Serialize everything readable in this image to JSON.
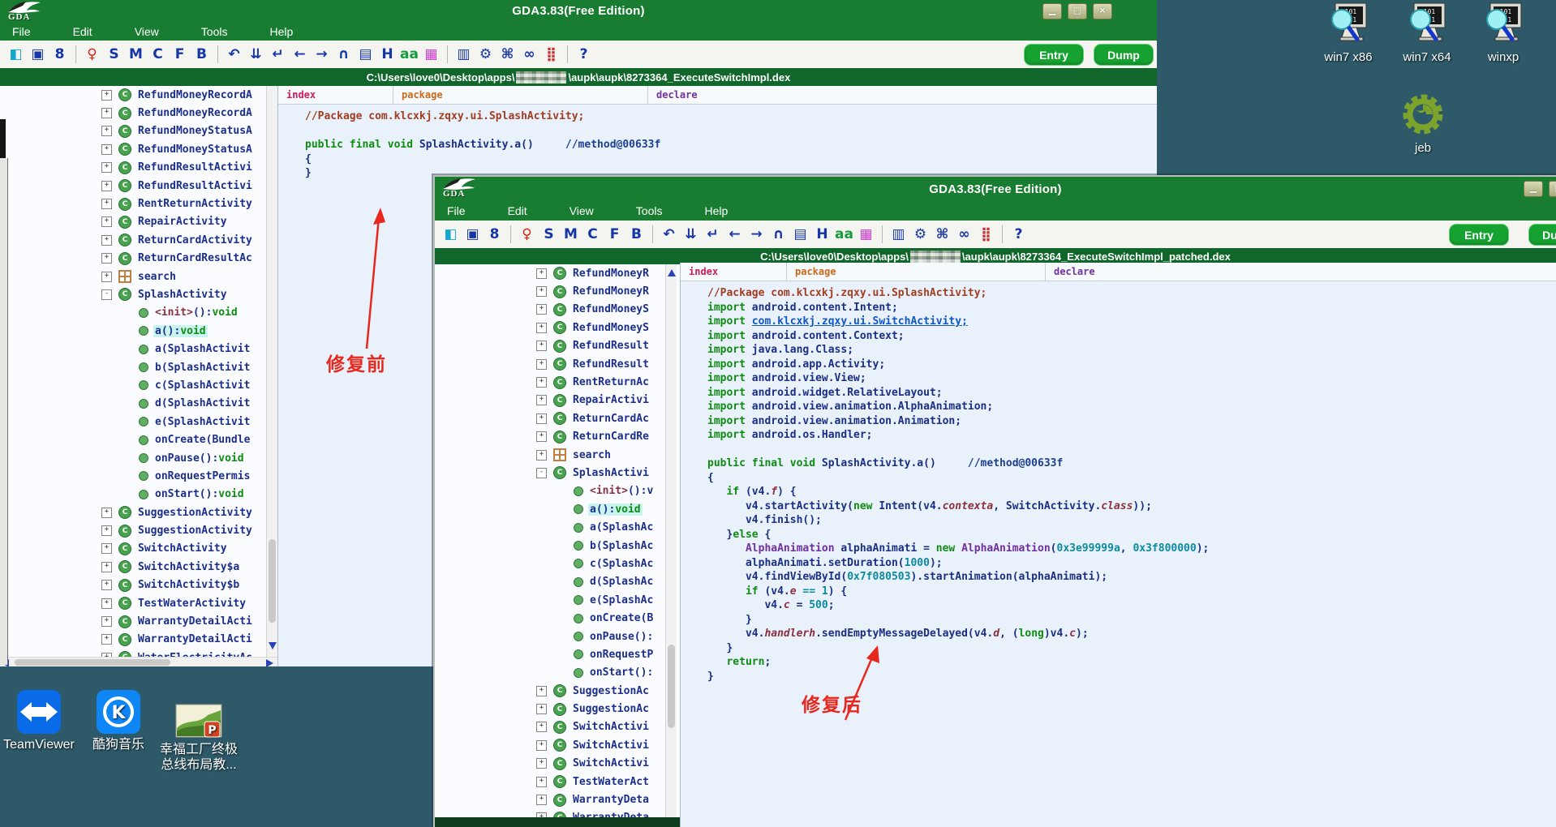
{
  "shared": {
    "title": "GDA3.83(Free Edition)",
    "logo": "GDA",
    "menus": [
      "File",
      "Edit",
      "View",
      "Tools",
      "Help"
    ],
    "toolbar": [
      {
        "g": "◧",
        "c": "#12a7cc",
        "n": "open-book-icon"
      },
      {
        "g": "▣",
        "c": "#1636a8",
        "n": "save-icon"
      },
      {
        "g": "8",
        "c": "#1636a8",
        "n": "link-icon"
      },
      {
        "sep": 1
      },
      {
        "g": "♀",
        "c": "#d42313",
        "n": "pin-icon"
      },
      {
        "g": "S",
        "c": "#1636a8",
        "n": "string-search-icon"
      },
      {
        "g": "M",
        "c": "#1636a8",
        "n": "method-icon"
      },
      {
        "g": "C",
        "c": "#1636a8",
        "n": "class-icon"
      },
      {
        "g": "F",
        "c": "#1636a8",
        "n": "field-icon"
      },
      {
        "g": "B",
        "c": "#1636a8",
        "n": "bytecode-icon"
      },
      {
        "sep": 1
      },
      {
        "g": "↶",
        "c": "#1636a8",
        "n": "undo-icon"
      },
      {
        "g": "⇊",
        "c": "#1636a8",
        "n": "jump-down-icon"
      },
      {
        "g": "↵",
        "c": "#1636a8",
        "n": "goto-icon"
      },
      {
        "g": "←",
        "c": "#1636a8",
        "n": "back-icon"
      },
      {
        "g": "→",
        "c": "#1636a8",
        "n": "forward-icon"
      },
      {
        "g": "∩",
        "c": "#1636a8",
        "n": "android-head-icon"
      },
      {
        "g": "▤",
        "c": "#1636a8",
        "n": "file-search-icon"
      },
      {
        "g": "H",
        "c": "#1636a8",
        "n": "hex-icon"
      },
      {
        "g": "aa",
        "c": "#159a3d",
        "n": "rename-icon"
      },
      {
        "g": "▦",
        "c": "#d03bd0",
        "n": "color-grid-icon"
      },
      {
        "sep": 1
      },
      {
        "g": "▥",
        "c": "#1636a8",
        "n": "xml-icon"
      },
      {
        "g": "⚙",
        "c": "#1636a8",
        "n": "apk-icon"
      },
      {
        "g": "⌘",
        "c": "#1636a8",
        "n": "command-icon"
      },
      {
        "g": "∞",
        "c": "#1636a8",
        "n": "rings-icon"
      },
      {
        "g": "⣿",
        "c": "#cc3333",
        "n": "dot-grid-icon"
      },
      {
        "sep": 1
      },
      {
        "g": "?",
        "c": "#1636a8",
        "n": "help-icon"
      }
    ],
    "entry": "Entry",
    "dump": "Dump",
    "headers": {
      "index": "index",
      "package": "package",
      "declare": "declare"
    }
  },
  "back": {
    "winbtns": [
      "▁",
      "□",
      "×"
    ],
    "path_prefix": "C:\\Users\\love0\\Desktop\\apps\\",
    "path_suffix": "\\aupk\\aupk\\8273364_ExecuteSwitchImpl.dex",
    "tree": [
      {
        "e": "+",
        "i": "c",
        "t": "RefundMoneyRecordA"
      },
      {
        "e": "+",
        "i": "c",
        "t": "RefundMoneyRecordA"
      },
      {
        "e": "+",
        "i": "c",
        "t": "RefundMoneyStatusA"
      },
      {
        "e": "+",
        "i": "c",
        "t": "RefundMoneyStatusA"
      },
      {
        "e": "+",
        "i": "c",
        "t": "RefundResultActivi"
      },
      {
        "e": "+",
        "i": "c",
        "t": "RefundResultActivi"
      },
      {
        "e": "+",
        "i": "c",
        "t": "RentReturnActivity"
      },
      {
        "e": "+",
        "i": "c",
        "t": "RepairActivity"
      },
      {
        "e": "+",
        "i": "c",
        "t": "ReturnCardActivity"
      },
      {
        "e": "+",
        "i": "c",
        "t": "ReturnCardResultAc"
      },
      {
        "e": "+",
        "i": "s",
        "t": "search"
      },
      {
        "e": "-",
        "i": "c",
        "t": "SplashActivity"
      },
      {
        "i": "m",
        "pre": "<init>",
        "t": "():",
        "suf": "void"
      },
      {
        "i": "m",
        "t": "a():",
        "suf": "void",
        "hl": true
      },
      {
        "i": "m",
        "t": "a(SplashActivit"
      },
      {
        "i": "m",
        "t": "b(SplashActivit"
      },
      {
        "i": "m",
        "t": "c(SplashActivit"
      },
      {
        "i": "m",
        "t": "d(SplashActivit"
      },
      {
        "i": "m",
        "t": "e(SplashActivit"
      },
      {
        "i": "m",
        "t": "onCreate(Bundle"
      },
      {
        "i": "m",
        "t": "onPause():",
        "suf": "void"
      },
      {
        "i": "m",
        "t": "onRequestPermis"
      },
      {
        "i": "m",
        "t": "onStart():",
        "suf": "void"
      },
      {
        "e": "+",
        "i": "c",
        "t": "SuggestionActivity"
      },
      {
        "e": "+",
        "i": "c",
        "t": "SuggestionActivity"
      },
      {
        "e": "+",
        "i": "c",
        "t": "SwitchActivity"
      },
      {
        "e": "+",
        "i": "c",
        "t": "SwitchActivity$a"
      },
      {
        "e": "+",
        "i": "c",
        "t": "SwitchActivity$b"
      },
      {
        "e": "+",
        "i": "c",
        "t": "TestWaterActivity"
      },
      {
        "e": "+",
        "i": "c",
        "t": "WarrantyDetailActi"
      },
      {
        "e": "+",
        "i": "c",
        "t": "WarrantyDetailActi"
      },
      {
        "e": "+",
        "i": "c",
        "t": "WaterElectricityAc"
      }
    ],
    "code": [
      {
        "seg": [
          {
            "t": "//Package com.klcxkj.zqxy.ui.SplashActivity;",
            "c": "cmt"
          }
        ]
      },
      {
        "seg": []
      },
      {
        "seg": [
          {
            "t": "public final void ",
            "c": "kw"
          },
          {
            "t": "SplashActivity.a()     ",
            "c": "id"
          },
          {
            "t": "//method@00633f",
            "c": "cm2"
          }
        ]
      },
      {
        "seg": [
          {
            "t": "{",
            "c": "id"
          }
        ]
      },
      {
        "seg": [
          {
            "t": "}",
            "c": "id"
          }
        ]
      }
    ]
  },
  "front": {
    "winbtns": [
      "▁",
      "□"
    ],
    "path_prefix": "C:\\Users\\love0\\Desktop\\apps\\",
    "path_suffix": "\\aupk\\aupk\\8273364_ExecuteSwitchImpl_patched.dex",
    "tree": [
      {
        "e": "+",
        "i": "c",
        "t": "RefundMoneyR"
      },
      {
        "e": "+",
        "i": "c",
        "t": "RefundMoneyR"
      },
      {
        "e": "+",
        "i": "c",
        "t": "RefundMoneyS"
      },
      {
        "e": "+",
        "i": "c",
        "t": "RefundMoneyS"
      },
      {
        "e": "+",
        "i": "c",
        "t": "RefundResult"
      },
      {
        "e": "+",
        "i": "c",
        "t": "RefundResult"
      },
      {
        "e": "+",
        "i": "c",
        "t": "RentReturnAc"
      },
      {
        "e": "+",
        "i": "c",
        "t": "RepairActivi"
      },
      {
        "e": "+",
        "i": "c",
        "t": "ReturnCardAc"
      },
      {
        "e": "+",
        "i": "c",
        "t": "ReturnCardRe"
      },
      {
        "e": "+",
        "i": "s",
        "t": "search"
      },
      {
        "e": "-",
        "i": "c",
        "t": "SplashActivi"
      },
      {
        "i": "m",
        "pre": "<init>",
        "t": "():v"
      },
      {
        "i": "m",
        "t": "a():",
        "suf": "void",
        "hl": true
      },
      {
        "i": "m",
        "t": "a(SplashAc"
      },
      {
        "i": "m",
        "t": "b(SplashAc"
      },
      {
        "i": "m",
        "t": "c(SplashAc"
      },
      {
        "i": "m",
        "t": "d(SplashAc"
      },
      {
        "i": "m",
        "t": "e(SplashAc"
      },
      {
        "i": "m",
        "t": "onCreate(B"
      },
      {
        "i": "m",
        "t": "onPause():"
      },
      {
        "i": "m",
        "t": "onRequestP"
      },
      {
        "i": "m",
        "t": "onStart():"
      },
      {
        "e": "+",
        "i": "c",
        "t": "SuggestionAc"
      },
      {
        "e": "+",
        "i": "c",
        "t": "SuggestionAc"
      },
      {
        "e": "+",
        "i": "c",
        "t": "SwitchActivi"
      },
      {
        "e": "+",
        "i": "c",
        "t": "SwitchActivi"
      },
      {
        "e": "+",
        "i": "c",
        "t": "SwitchActivi"
      },
      {
        "e": "+",
        "i": "c",
        "t": "TestWaterAct"
      },
      {
        "e": "+",
        "i": "c",
        "t": "WarrantyDeta"
      },
      {
        "e": "+",
        "i": "c",
        "t": "WarrantyDeta"
      }
    ],
    "code": [
      {
        "seg": [
          {
            "t": "//Package com.klcxkj.zqxy.ui.SplashActivity;",
            "c": "cmt"
          }
        ]
      },
      {
        "seg": [
          {
            "t": "import ",
            "c": "kw"
          },
          {
            "t": "android.content.Intent;",
            "c": "id"
          }
        ]
      },
      {
        "seg": [
          {
            "t": "import ",
            "c": "kw"
          },
          {
            "t": "com.klcxkj.zqxy.ui.SwitchActivity;",
            "c": "lnk"
          }
        ]
      },
      {
        "seg": [
          {
            "t": "import ",
            "c": "kw"
          },
          {
            "t": "android.content.Context;",
            "c": "id"
          }
        ]
      },
      {
        "seg": [
          {
            "t": "import ",
            "c": "kw"
          },
          {
            "t": "java.lang.Class;",
            "c": "id"
          }
        ]
      },
      {
        "seg": [
          {
            "t": "import ",
            "c": "kw"
          },
          {
            "t": "android.app.Activity;",
            "c": "id"
          }
        ]
      },
      {
        "seg": [
          {
            "t": "import ",
            "c": "kw"
          },
          {
            "t": "android.view.View;",
            "c": "id"
          }
        ]
      },
      {
        "seg": [
          {
            "t": "import ",
            "c": "kw"
          },
          {
            "t": "android.widget.RelativeLayout;",
            "c": "id"
          }
        ]
      },
      {
        "seg": [
          {
            "t": "import ",
            "c": "kw"
          },
          {
            "t": "android.view.animation.AlphaAnimation;",
            "c": "id"
          }
        ]
      },
      {
        "seg": [
          {
            "t": "import ",
            "c": "kw"
          },
          {
            "t": "android.view.animation.Animation;",
            "c": "id"
          }
        ]
      },
      {
        "seg": [
          {
            "t": "import ",
            "c": "kw"
          },
          {
            "t": "android.os.Handler;",
            "c": "id"
          }
        ]
      },
      {
        "seg": []
      },
      {
        "seg": [
          {
            "t": "public final void ",
            "c": "kw"
          },
          {
            "t": "SplashActivity.a()     ",
            "c": "id"
          },
          {
            "t": "//method@00633f",
            "c": "cm2"
          }
        ]
      },
      {
        "seg": [
          {
            "t": "{",
            "c": "id"
          }
        ]
      },
      {
        "seg": [
          {
            "t": "   ",
            "c": "id"
          },
          {
            "t": "if",
            "c": "kw"
          },
          {
            "t": " (v4.",
            "c": "id"
          },
          {
            "t": "f",
            "c": "fld"
          },
          {
            "t": ") {",
            "c": "id"
          }
        ]
      },
      {
        "seg": [
          {
            "t": "      v4.startActivity(",
            "c": "id"
          },
          {
            "t": "new",
            "c": "kw"
          },
          {
            "t": " Intent(v4.",
            "c": "id"
          },
          {
            "t": "contexta",
            "c": "fld"
          },
          {
            "t": ", SwitchActivity.",
            "c": "id"
          },
          {
            "t": "class",
            "c": "fld"
          },
          {
            "t": "));",
            "c": "id"
          }
        ]
      },
      {
        "seg": [
          {
            "t": "      v4.finish();",
            "c": "id"
          }
        ]
      },
      {
        "seg": [
          {
            "t": "   }",
            "c": "id"
          },
          {
            "t": "else",
            "c": "kw"
          },
          {
            "t": " {",
            "c": "id"
          }
        ]
      },
      {
        "seg": [
          {
            "t": "      ",
            "c": "id"
          },
          {
            "t": "AlphaAnimation",
            "c": "typ"
          },
          {
            "t": " alphaAnimati = ",
            "c": "id"
          },
          {
            "t": "new",
            "c": "kw"
          },
          {
            "t": " ",
            "c": "id"
          },
          {
            "t": "AlphaAnimation",
            "c": "typ"
          },
          {
            "t": "(",
            "c": "id"
          },
          {
            "t": "0x3e99999a",
            "c": "num"
          },
          {
            "t": ", ",
            "c": "id"
          },
          {
            "t": "0x3f800000",
            "c": "num"
          },
          {
            "t": ");",
            "c": "id"
          }
        ]
      },
      {
        "seg": [
          {
            "t": "      alphaAnimati.setDuration(",
            "c": "id"
          },
          {
            "t": "1000",
            "c": "num"
          },
          {
            "t": ");",
            "c": "id"
          }
        ]
      },
      {
        "seg": [
          {
            "t": "      v4.findViewById(",
            "c": "id"
          },
          {
            "t": "0x7f080503",
            "c": "num"
          },
          {
            "t": ").startAnimation(alphaAnimati);",
            "c": "id"
          }
        ]
      },
      {
        "seg": [
          {
            "t": "      ",
            "c": "id"
          },
          {
            "t": "if",
            "c": "kw"
          },
          {
            "t": " (v4.",
            "c": "id"
          },
          {
            "t": "e",
            "c": "fld"
          },
          {
            "t": " ",
            "c": "id"
          },
          {
            "t": "==",
            "c": "num"
          },
          {
            "t": " ",
            "c": "id"
          },
          {
            "t": "1",
            "c": "num"
          },
          {
            "t": ") {",
            "c": "id"
          }
        ]
      },
      {
        "seg": [
          {
            "t": "         v4.",
            "c": "id"
          },
          {
            "t": "c",
            "c": "fld"
          },
          {
            "t": " = ",
            "c": "id"
          },
          {
            "t": "500",
            "c": "num"
          },
          {
            "t": ";",
            "c": "id"
          }
        ]
      },
      {
        "seg": [
          {
            "t": "      }",
            "c": "id"
          }
        ]
      },
      {
        "seg": [
          {
            "t": "      v4.",
            "c": "id"
          },
          {
            "t": "handlerh",
            "c": "fld"
          },
          {
            "t": ".sendEmptyMessageDelayed(v4.",
            "c": "id"
          },
          {
            "t": "d",
            "c": "fld"
          },
          {
            "t": ", (",
            "c": "id"
          },
          {
            "t": "long",
            "c": "kw"
          },
          {
            "t": ")v4.",
            "c": "id"
          },
          {
            "t": "c",
            "c": "fld"
          },
          {
            "t": ");",
            "c": "id"
          }
        ]
      },
      {
        "seg": [
          {
            "t": "   }",
            "c": "id"
          }
        ]
      },
      {
        "seg": [
          {
            "t": "   ",
            "c": "id"
          },
          {
            "t": "return",
            "c": "kw"
          },
          {
            "t": ";",
            "c": "id"
          }
        ]
      },
      {
        "seg": [
          {
            "t": "}",
            "c": "id"
          }
        ]
      }
    ]
  },
  "annotations": {
    "before": "修复前",
    "after": "修复后"
  },
  "desktop": {
    "vm_icons": [
      {
        "label": "win7 x86"
      },
      {
        "label": "win7 x64"
      },
      {
        "label": "winxp"
      }
    ],
    "jeb_label": "jeb",
    "shortcut_teamviewer": "TeamViewer",
    "shortcut_kugou": "酷狗音乐",
    "shortcut_ppt_line1": "幸福工厂终极",
    "shortcut_ppt_line2": "总线布局教..."
  }
}
